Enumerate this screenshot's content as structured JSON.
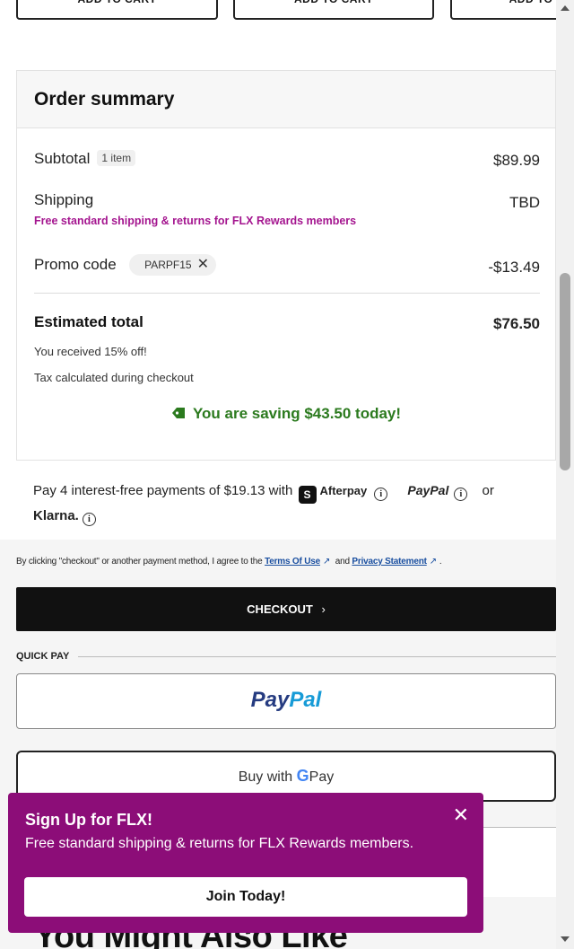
{
  "add_to_cart": [
    "ADD TO CART",
    "ADD TO CART",
    "ADD TO"
  ],
  "order_summary": {
    "title": "Order summary",
    "subtotal_label": "Subtotal",
    "item_count": "1 item",
    "subtotal_value": "$89.99",
    "shipping_label": "Shipping",
    "shipping_value": "TBD",
    "shipping_note": "Free standard shipping & returns for FLX Rewards members",
    "promo_label": "Promo code",
    "promo_code": "PARPF15",
    "promo_value": "-$13.49",
    "estimated_label": "Estimated total",
    "estimated_value": "$76.50",
    "discount_note": "You received 15% off!",
    "tax_note": "Tax calculated during checkout",
    "saving_text": "You are saving $43.50 today!"
  },
  "bnpl": {
    "text": "Pay 4 interest-free payments of $19.13 with",
    "afterpay": "Afterpay",
    "paypal": "PayPal",
    "or": "or",
    "klarna": "Klarna."
  },
  "legal": {
    "prefix": "By clicking \"checkout\" or another payment method, I agree to the",
    "terms": "Terms Of Use",
    "and": "and",
    "privacy": "Privacy Statement",
    "suffix": "."
  },
  "checkout_label": "CHECKOUT",
  "quick_pay_label": "QUICK PAY",
  "paypal_button": {
    "pay": "Pay",
    "pal": "Pal"
  },
  "gpay_button": {
    "prefix": "Buy with",
    "g": "G",
    "pay": "Pay"
  },
  "toast": {
    "title": "Sign Up for FLX!",
    "text": "Free standard shipping & returns for FLX Rewards members.",
    "button": "Join Today!"
  },
  "section_heading": "You Might Also Like",
  "colors": {
    "promo_purple": "#a4158f",
    "saving_green": "#2b7a1e",
    "toast_bg": "#8c0d78",
    "checkout_bg": "#111111"
  }
}
